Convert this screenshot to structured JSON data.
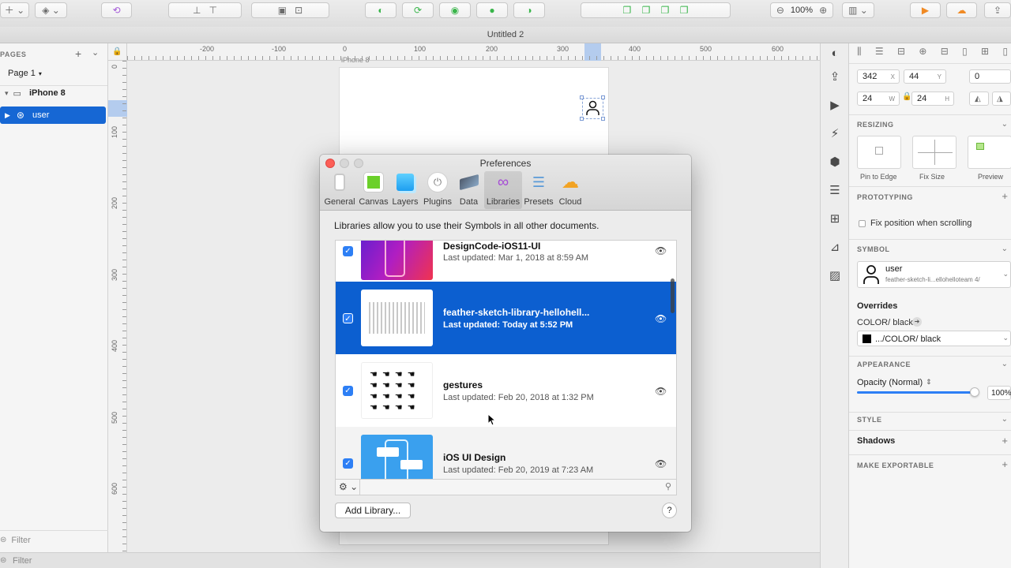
{
  "window": {
    "title": "Untitled 2"
  },
  "toolbar": {
    "zoom": "100%"
  },
  "sidebar": {
    "pages_header": "PAGES",
    "add_symbol": "+",
    "chevron": "⌄",
    "current_page": "Page 1",
    "layers": [
      {
        "label": "iPhone 8"
      },
      {
        "label": "user"
      }
    ],
    "filter_placeholder": "Filter",
    "bottom_filter": "Filter"
  },
  "rulers": {
    "top": [
      "-200",
      "-100",
      "0",
      "100",
      "200",
      "300",
      "400",
      "500",
      "600"
    ],
    "left": [
      "0",
      "100",
      "200",
      "300",
      "400",
      "500",
      "600"
    ]
  },
  "artboard": {
    "label": "iPhone 8"
  },
  "inspector": {
    "x": "342",
    "x_suffix": "X",
    "y": "44",
    "y_suffix": "Y",
    "rotation": "0",
    "w": "24",
    "w_suffix": "W",
    "h": "24",
    "h_suffix": "H",
    "resizing_header": "RESIZING",
    "pin_to_edge": "Pin to Edge",
    "fix_size": "Fix Size",
    "preview": "Preview",
    "prototyping_header": "PROTOTYPING",
    "fix_position_label": "Fix position when scrolling",
    "symbol_header": "SYMBOL",
    "symbol_name": "user",
    "symbol_source": "feather-sketch-li...ellohelloteam 4/",
    "overrides_header": "Overrides",
    "override_label": "COLOR/ black",
    "override_value": ".../COLOR/ black",
    "appearance_header": "APPEARANCE",
    "opacity_label": "Opacity (Normal)",
    "opacity_value": "100%",
    "opacity_fraction": 0.96,
    "style_header": "STYLE",
    "shadows_label": "Shadows",
    "exportable_header": "MAKE EXPORTABLE"
  },
  "preferences": {
    "title": "Preferences",
    "tabs": [
      {
        "label": "General"
      },
      {
        "label": "Canvas"
      },
      {
        "label": "Layers"
      },
      {
        "label": "Plugins"
      },
      {
        "label": "Data"
      },
      {
        "label": "Libraries"
      },
      {
        "label": "Presets"
      },
      {
        "label": "Cloud"
      }
    ],
    "active_tab": "Libraries",
    "description": "Libraries allow you to use their Symbols in all other documents.",
    "libraries": [
      {
        "name": "DesignCode-iOS11-UI",
        "updated": "Last updated: Mar 1, 2018 at 8:59 AM",
        "checked": true,
        "selected": false
      },
      {
        "name": "feather-sketch-library-hellohell...",
        "updated": "Last updated: Today at 5:52 PM",
        "checked": true,
        "selected": true
      },
      {
        "name": "gestures",
        "updated": "Last updated: Feb 20, 2018 at 1:32 PM",
        "checked": true,
        "selected": false
      },
      {
        "name": "iOS UI Design",
        "updated": "Last updated: Feb 20, 2019 at 7:23 AM",
        "checked": true,
        "selected": false
      }
    ],
    "add_library_label": "Add Library...",
    "help_label": "?",
    "search_placeholder": ""
  },
  "colors": {
    "accent": "#0c5fd0",
    "checkbox": "#2d7ff5",
    "close": "#fc5f57"
  }
}
